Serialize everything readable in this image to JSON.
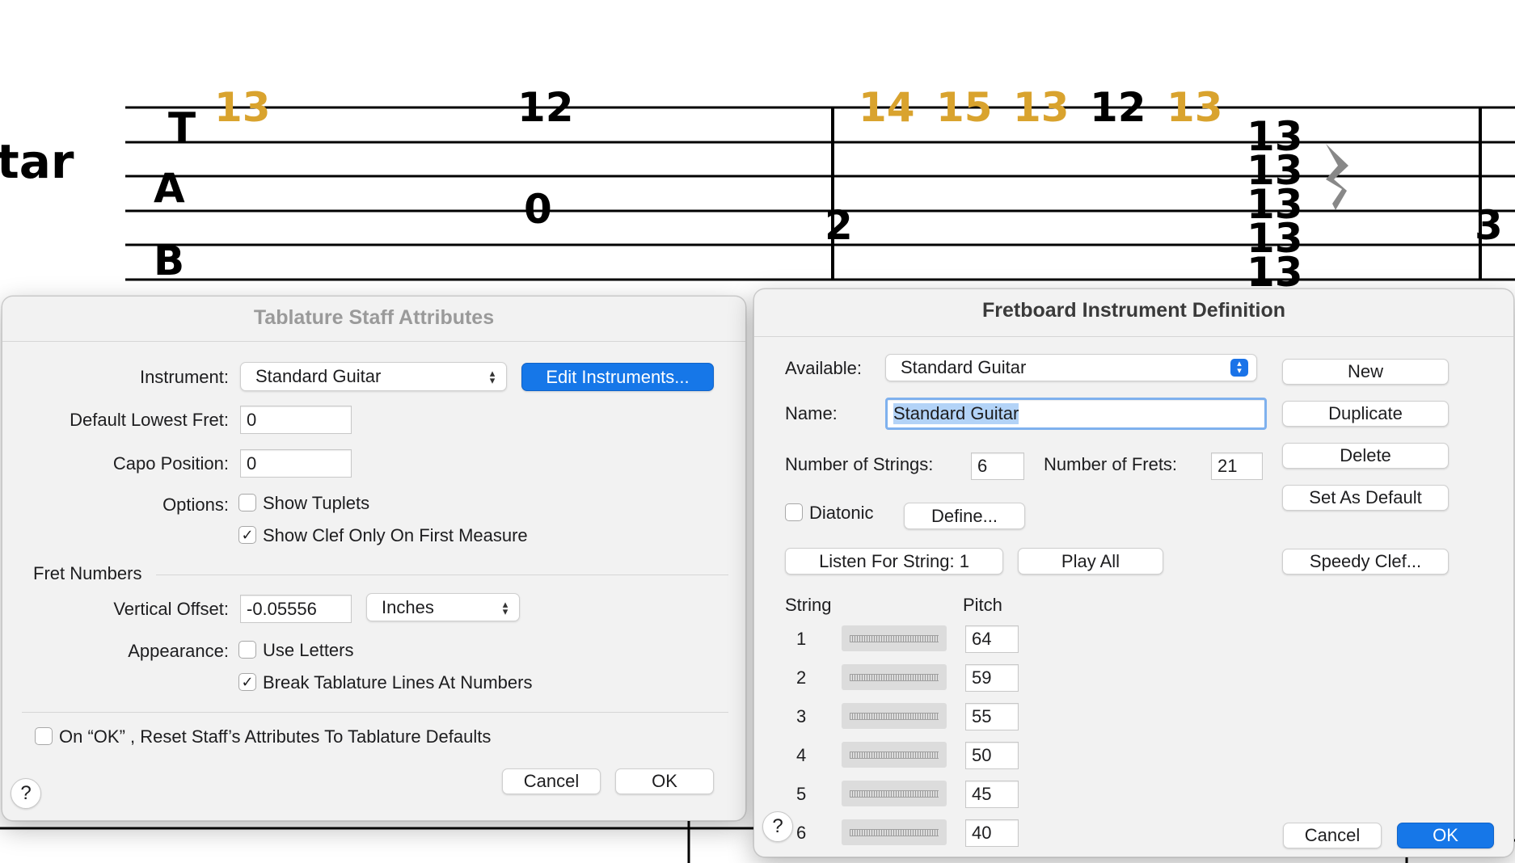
{
  "score": {
    "instrument_label": "tar",
    "clef": [
      "T",
      "A",
      "B"
    ],
    "top_numbers": [
      {
        "text": "13",
        "color": "#d9a32e"
      },
      {
        "text": "12",
        "color": "#000000"
      },
      {
        "text": "14",
        "color": "#d9a32e"
      },
      {
        "text": "15",
        "color": "#d9a32e"
      },
      {
        "text": "13",
        "color": "#d9a32e"
      },
      {
        "text": "12",
        "color": "#000000"
      },
      {
        "text": "13",
        "color": "#d9a32e"
      }
    ],
    "chord_numbers": [
      "13",
      "13",
      "13",
      "13",
      "13"
    ],
    "other_numbers": [
      "0"
    ],
    "measure_numbers": [
      "2",
      "3"
    ]
  },
  "tab_dialog": {
    "title": "Tablature Staff Attributes",
    "instrument_label": "Instrument:",
    "instrument_value": "Standard Guitar",
    "edit_instruments": "Edit Instruments...",
    "lowest_fret_label": "Default Lowest Fret:",
    "lowest_fret_value": "0",
    "capo_label": "Capo Position:",
    "capo_value": "0",
    "options_label": "Options:",
    "show_tuplets": "Show Tuplets",
    "show_tuplets_checked": false,
    "show_clef_first": "Show Clef Only On First Measure",
    "show_clef_first_checked": true,
    "fret_numbers_section": "Fret Numbers",
    "vertical_offset_label": "Vertical Offset:",
    "vertical_offset_value": "-0.05556",
    "units_value": "Inches",
    "appearance_label": "Appearance:",
    "use_letters": "Use Letters",
    "use_letters_checked": false,
    "break_lines": "Break Tablature Lines At Numbers",
    "break_lines_checked": true,
    "reset_label": "On “OK” , Reset Staff’s Attributes To Tablature Defaults",
    "reset_checked": false,
    "cancel": "Cancel",
    "ok": "OK",
    "help": "?"
  },
  "fret_dialog": {
    "title": "Fretboard Instrument Definition",
    "available_label": "Available:",
    "available_value": "Standard Guitar",
    "name_label": "Name:",
    "name_value": "Standard Guitar",
    "strings_label": "Number of Strings:",
    "strings_value": "6",
    "frets_label": "Number of Frets:",
    "frets_value": "21",
    "diatonic": "Diatonic",
    "diatonic_checked": false,
    "define": "Define...",
    "listen": "Listen For String: 1",
    "play_all": "Play All",
    "new": "New",
    "duplicate": "Duplicate",
    "delete": "Delete",
    "set_default": "Set As Default",
    "speedy_clef": "Speedy Clef...",
    "string_col": "String",
    "pitch_col": "Pitch",
    "strings": [
      {
        "num": "1",
        "pitch": "64"
      },
      {
        "num": "2",
        "pitch": "59"
      },
      {
        "num": "3",
        "pitch": "55"
      },
      {
        "num": "4",
        "pitch": "50"
      },
      {
        "num": "5",
        "pitch": "45"
      },
      {
        "num": "6",
        "pitch": "40"
      }
    ],
    "cancel": "Cancel",
    "ok": "OK",
    "help": "?"
  },
  "colors": {
    "accent": "#1677e8",
    "highlight_number": "#d9a32e",
    "dialog_bg": "#f2f2f2"
  }
}
